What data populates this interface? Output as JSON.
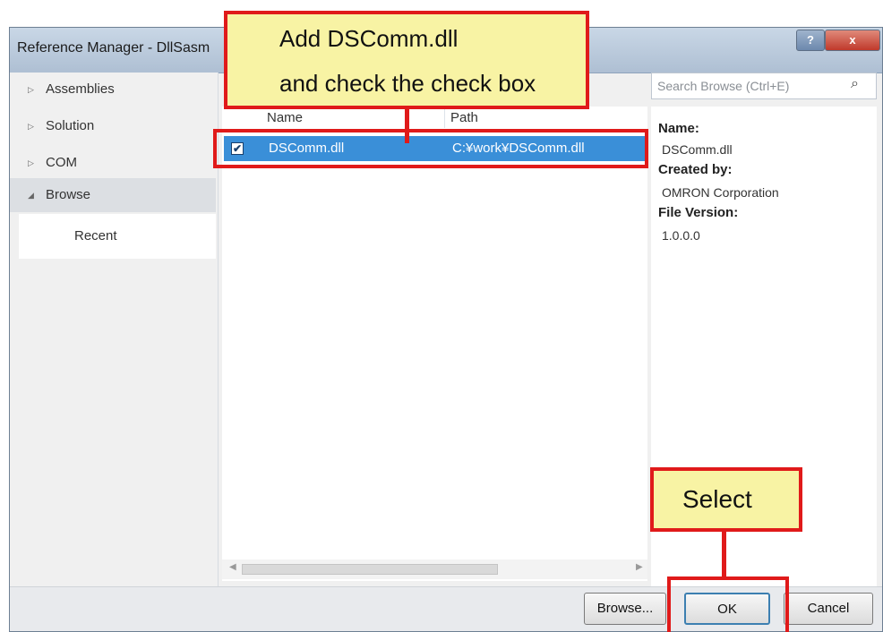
{
  "window": {
    "title": "Reference Manager - DllSasm"
  },
  "title_buttons": {
    "help": "?",
    "close": "x"
  },
  "sidebar": {
    "items": [
      {
        "label": "Assemblies",
        "arrow": "▷"
      },
      {
        "label": "Solution",
        "arrow": "▷"
      },
      {
        "label": "COM",
        "arrow": "▷"
      },
      {
        "label": "Browse",
        "arrow": "◢"
      }
    ],
    "subitem": "Recent"
  },
  "list": {
    "columns": [
      "Name",
      "Path"
    ],
    "rows": [
      {
        "checked": true,
        "check_mark": "✔",
        "name": "DSComm.dll",
        "path": "C:¥work¥DSComm.dll"
      }
    ]
  },
  "search": {
    "placeholder": "Search Browse (Ctrl+E)",
    "icon": "search-icon"
  },
  "details": {
    "name_label": "Name:",
    "name_value": "DSComm.dll",
    "created_label": "Created by:",
    "created_value": "OMRON Corporation",
    "version_label": "File Version:",
    "version_value": "1.0.0.0"
  },
  "footer": {
    "browse_label": "Browse...",
    "ok_label": "OK",
    "cancel_label": "Cancel"
  },
  "annotations": {
    "callout1_line1": "Add DSComm.dll",
    "callout1_line2": "and check the check box",
    "callout2": "Select"
  },
  "colors": {
    "accent": "#3a8fd8",
    "callout_border": "#e01a1a",
    "callout_fill": "#f8f3a4"
  }
}
